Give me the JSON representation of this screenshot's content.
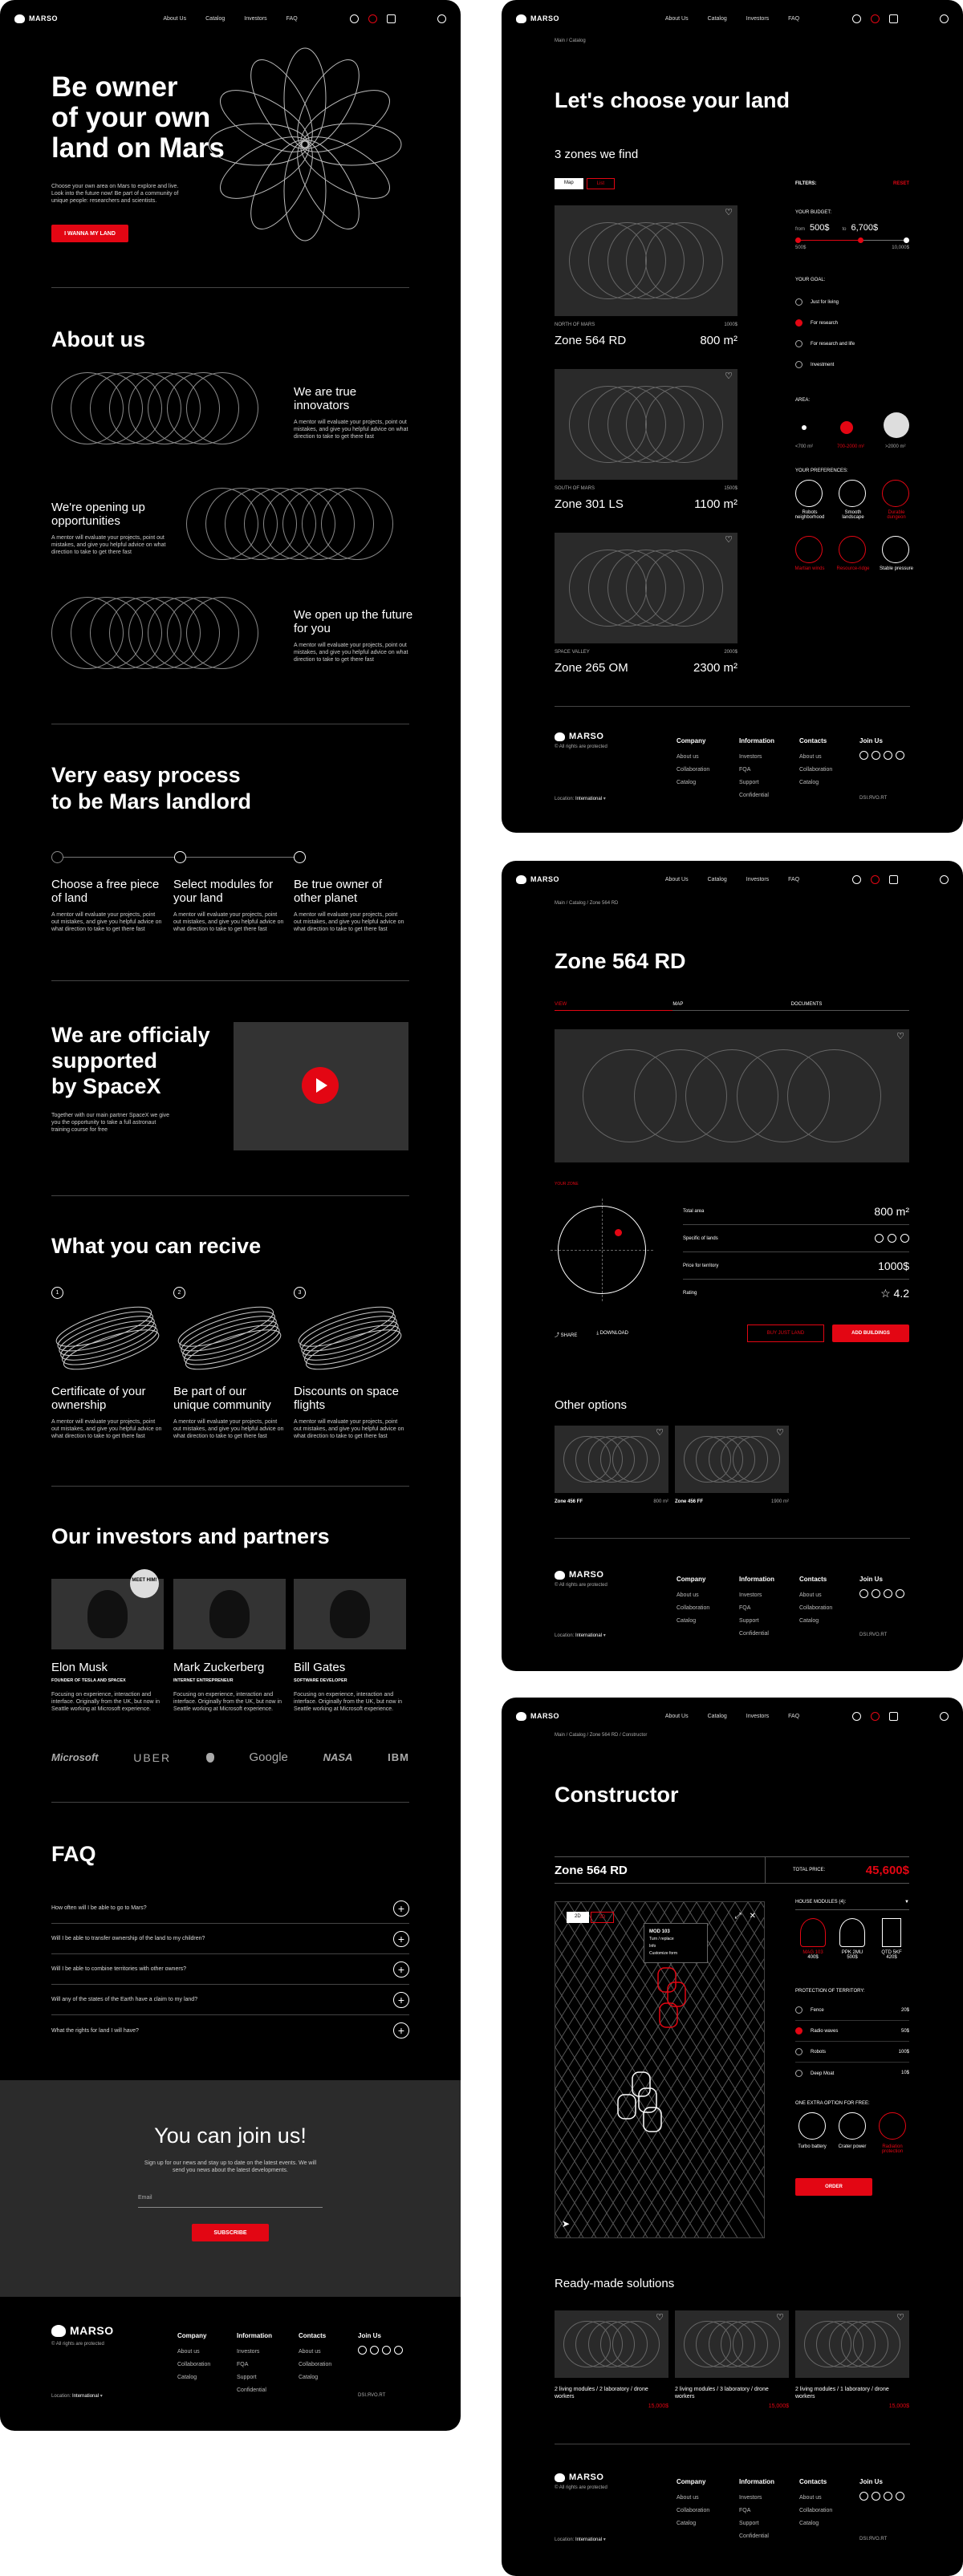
{
  "nav": {
    "brand": "MARSO",
    "links": [
      "About Us",
      "Catalog",
      "Investors",
      "FAQ"
    ]
  },
  "home": {
    "hero_title": [
      "Be owner",
      "of your own",
      "land on Mars"
    ],
    "hero_text": "Choose your own area on Mars to explore and live. Look into the future now! Be part of a community of unique people: researchers and scientists.",
    "hero_btn": "I WANNA MY LAND",
    "about_title": "About us",
    "about": [
      {
        "title": "We are true innovators",
        "text": "A mentor will evaluate your projects, point out mistakes, and give you helpful advice on what direction to take to get there fast"
      },
      {
        "title": "We're opening up opportunities",
        "text": "A mentor will evaluate your projects, point out mistakes, and give you helpful advice on what direction to take to get there fast"
      },
      {
        "title": "We open up the future for you",
        "text": "A mentor will evaluate your projects, point out mistakes, and give you helpful advice on what direction to take to get there fast"
      }
    ],
    "process_title": [
      "Very easy process",
      "to be Mars landlord"
    ],
    "process": [
      {
        "title": "Choose a free piece of land",
        "text": "A mentor will evaluate your projects, point out mistakes, and give you helpful advice on what direction to take to get there fast"
      },
      {
        "title": "Select modules for your land",
        "text": "A mentor will evaluate your projects, point out mistakes, and give you helpful advice on what direction to take to get there fast"
      },
      {
        "title": "Be true owner of other planet",
        "text": "A mentor will evaluate your projects, point out mistakes, and give you helpful advice on what direction to take to get there fast"
      }
    ],
    "spacex_title": [
      "We are officialy",
      "supported",
      "by SpaceX"
    ],
    "spacex_text": "Together with our main partner SpaceX we give you the opportunity to take a full astronaut training course for free",
    "receive_title": "What you can recive",
    "receive": [
      {
        "num": "1",
        "title": "Certificate of your ownership",
        "text": "A mentor will evaluate your projects, point out mistakes, and give you helpful advice on what direction to take to get there fast"
      },
      {
        "num": "2",
        "title": "Be part of our unique community",
        "text": "A mentor will evaluate your projects, point out mistakes, and give you helpful advice on what direction to take to get there fast"
      },
      {
        "num": "3",
        "title": "Discounts on space flights",
        "text": "A mentor will evaluate your projects, point out mistakes, and give you helpful advice on what direction to take to get there fast"
      }
    ],
    "investors_title": "Our investors and partners",
    "meet_badge": "MEET HIM!",
    "investors": [
      {
        "name": "Elon Musk",
        "role": "FOUNDER OF TESLA AND SPACEX",
        "text": "Focusing on experience, interaction and interface. Originally from the UK, but now in Seattle working at Microsoft experience."
      },
      {
        "name": "Mark Zuckerberg",
        "role": "INTERNET ENTREPRENEUR",
        "text": "Focusing on experience, interaction and interface. Originally from the UK, but now in Seattle working at Microsoft experience."
      },
      {
        "name": "Bill Gates",
        "role": "SOFTWARE DEVELOPER",
        "text": "Focusing on experience, interaction and interface. Originally from the UK, but now in Seattle working at Microsoft experience."
      }
    ],
    "partners": [
      "Microsoft",
      "UBER",
      "",
      "Google",
      "NASA",
      "IBM"
    ],
    "faq_title": "FAQ",
    "faq": [
      "How often will I be able to go to Mars?",
      "Will I be able to transfer ownership of the land to my children?",
      "Will I be able to combine territories with other owners?",
      "Will any of the states of the Earth have a claim to my land?",
      "What the rights for land I will have?"
    ],
    "join_title": "You can join us!",
    "join_text": "Sign up for our news and stay up to date on the latest events. We will send you news about the latest developments.",
    "email_placeholder": "Email",
    "subscribe": "SUBSCRIBE"
  },
  "footer": {
    "rights": "© All rights are protected",
    "location": "Location:",
    "location_value": "International",
    "company": {
      "title": "Company",
      "items": [
        "About us",
        "Collaboration",
        "Catalog"
      ]
    },
    "information": {
      "title": "Information",
      "items": [
        "Investors",
        "FQA",
        "Support",
        "Confidential"
      ]
    },
    "contacts": {
      "title": "Contacts",
      "items": [
        "About us",
        "Collaboration",
        "Catalog"
      ]
    },
    "join": "Join Us",
    "credit": "DSI.ЯVO.RT"
  },
  "catalog": {
    "breadcrumb": "Main / Catalog",
    "title": "Let's choose your land",
    "subtitle": "3 zones we find",
    "toggle": [
      "Map",
      "List"
    ],
    "zones": [
      {
        "loc": "NORTH OF MARS",
        "price": "1000$",
        "name": "Zone 564 RD",
        "area": "800 m²"
      },
      {
        "loc": "SOUTH OF MARS",
        "price": "1500$",
        "name": "Zone 301 LS",
        "area": "1100 m²"
      },
      {
        "loc": "SPACE VALLEY",
        "price": "2000$",
        "name": "Zone 265 OM",
        "area": "2300 m²"
      }
    ],
    "filters": "FILTERS:",
    "reset": "RESET",
    "budget": "YOUR BUDGET:",
    "from": "from",
    "from_val": "500$",
    "to": "to",
    "to_val": "6,700$",
    "range_min": "500$",
    "range_max": "10,000$",
    "goal": "YOUR GOAL:",
    "goals": [
      "Just for living",
      "For research",
      "For research and life",
      "Investment"
    ],
    "area_label": "AREA:",
    "areas": [
      "<700 m²",
      "700-2000 m²",
      ">2000 m²"
    ],
    "prefs_label": "YOUR PREFERENCES:",
    "prefs": [
      "Robots neighborhood",
      "Smooth landscape",
      "Durable dungeon",
      "Martian winds",
      "Resource-ridge",
      "Stable pressure"
    ]
  },
  "zone": {
    "breadcrumb": "Main / Catalog / Zone 564 RD",
    "title": "Zone 564 RD",
    "tabs": [
      "VIEW",
      "MAP",
      "DOCUMENTS"
    ],
    "map_label": "YOUR ZONE",
    "rows": [
      {
        "k": "Total area",
        "v": "800 m²"
      },
      {
        "k": "Specific of lands",
        "v": ""
      },
      {
        "k": "Price for territory",
        "v": "1000$"
      },
      {
        "k": "Rating",
        "v": "4.2"
      }
    ],
    "share": "SHARE",
    "download": "DOWNLOAD",
    "buy": "BUY JUST LAND",
    "add": "ADD BUILDINGS",
    "other": "Other options",
    "others": [
      {
        "name": "Zone 456 FF",
        "area": "800 m²"
      },
      {
        "name": "Zone 456 FF",
        "area": "1900 m²"
      }
    ]
  },
  "constructor": {
    "breadcrumb": "Main / Catalog / Zone 564 RD / Constructor",
    "title": "Constructor",
    "zone": "Zone 564 RD",
    "total_label": "TOTAL PRICE:",
    "total": "45,600$",
    "view_btns": [
      "2D",
      "3D"
    ],
    "tip_title": "MOD 103",
    "tip_items": [
      "Turn / replace",
      "Info",
      "Customize form"
    ],
    "modules_label": "HOUSE MODULES (4):",
    "modules": [
      {
        "name": "MAG 103",
        "price": "400$"
      },
      {
        "name": "PPK 2MU",
        "price": "500$"
      },
      {
        "name": "QTD 5KF",
        "price": "420$"
      }
    ],
    "protection": "PROTECTION OF TERRITORY:",
    "protections": [
      {
        "name": "Fence",
        "price": "20$"
      },
      {
        "name": "Radio waves",
        "price": "50$"
      },
      {
        "name": "Robots",
        "price": "100$"
      },
      {
        "name": "Deep Moat",
        "price": "10$"
      }
    ],
    "extra": "ONE EXTRA OPTION FOR FREE:",
    "extras": [
      "Turbo battery",
      "Crater power",
      "Radiation protection"
    ],
    "order": "ORDER",
    "ready": "Ready-made solutions",
    "solutions": [
      {
        "text": "2 living modules / 2 laboratory / drone workers",
        "price": "15,000$"
      },
      {
        "text": "2 living modules / 3 laboratory / drone workers",
        "price": "15,000$"
      },
      {
        "text": "2 living modules / 1 laboratory / drone workers",
        "price": "15,000$"
      }
    ]
  }
}
